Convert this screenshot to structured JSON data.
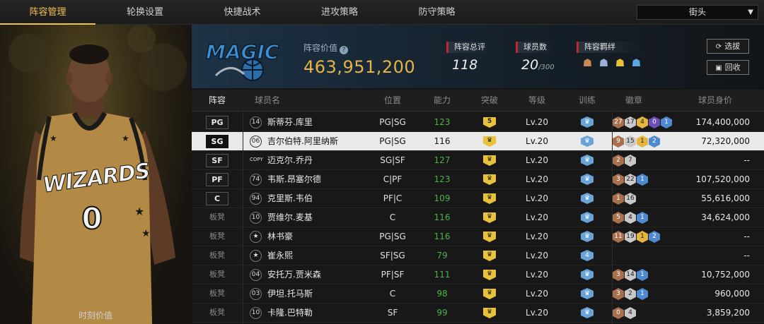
{
  "tabs": [
    {
      "label": "阵容管理",
      "active": true
    },
    {
      "label": "轮换设置"
    },
    {
      "label": "快捷战术"
    },
    {
      "label": "进攻策略"
    },
    {
      "label": "防守策略"
    }
  ],
  "dropdown": {
    "value": "街头"
  },
  "player_panel": {
    "caption": "时刻价值",
    "jersey_team": "WIZARDS",
    "jersey_number": "0"
  },
  "team": {
    "logo_text": "MAGIC",
    "value_label": "阵容价值",
    "value": "463,951,200",
    "rating_label": "阵容总评",
    "rating": "118",
    "players_label": "球员数",
    "players_count": "20",
    "players_max": "/300",
    "bond_label": "阵容羁绊",
    "bond_icons": [
      "team-bond-icon-1",
      "team-bond-icon-2",
      "team-bond-icon-3",
      "team-bond-icon-4"
    ]
  },
  "buttons": {
    "select": "选拔",
    "recycle": "回收"
  },
  "columns": [
    "阵容",
    "球员名",
    "位置",
    "能力",
    "突破",
    "等级",
    "训练",
    "徽章",
    "球员身价"
  ],
  "rows": [
    {
      "slot": "PG",
      "jersey": "14",
      "name": "斯蒂芬.库里",
      "pos": "PG|SG",
      "ability": "123",
      "breakthrough": "5",
      "level": "Lv.20",
      "training": "",
      "badges": [
        [
          "bronze",
          "27"
        ],
        [
          "silver",
          "17"
        ],
        [
          "gold",
          "4"
        ],
        [
          "purple",
          "0"
        ],
        [
          "blue",
          "1"
        ]
      ],
      "price": "174,400,000"
    },
    {
      "slot": "SG",
      "jersey": "06",
      "name": "吉尔伯特.阿里纳斯",
      "pos": "PG|SG",
      "ability": "116",
      "breakthrough": "crown",
      "level": "Lv.20",
      "training": "",
      "badges": [
        [
          "bronze",
          "9"
        ],
        [
          "silver",
          "15"
        ],
        [
          "gold",
          "1"
        ],
        [
          "blue",
          "2"
        ]
      ],
      "price": "72,320,000",
      "selected": true
    },
    {
      "slot": "SF",
      "jersey": "COPY",
      "name": "迈克尔.乔丹",
      "pos": "SG|SF",
      "ability": "127",
      "breakthrough": "crown",
      "level": "Lv.20",
      "training": "",
      "badges": [
        [
          "bronze",
          "2"
        ],
        [
          "silver",
          "7"
        ]
      ],
      "price": "--"
    },
    {
      "slot": "PF",
      "jersey": "74",
      "name": "韦斯.昂塞尔德",
      "pos": "C|PF",
      "ability": "123",
      "breakthrough": "crown",
      "level": "Lv.20",
      "training": "",
      "badges": [
        [
          "bronze",
          "3"
        ],
        [
          "silver",
          "22"
        ],
        [
          "blue",
          "1"
        ]
      ],
      "price": "107,520,000"
    },
    {
      "slot": "C",
      "jersey": "94",
      "name": "克里斯.韦伯",
      "pos": "PF|C",
      "ability": "109",
      "breakthrough": "crown",
      "level": "Lv.20",
      "training": "",
      "badges": [
        [
          "bronze",
          "1"
        ],
        [
          "silver",
          "16"
        ]
      ],
      "price": "55,616,000"
    },
    {
      "slot": "板凳",
      "jersey": "10",
      "name": "贾维尔.麦基",
      "pos": "C",
      "ability": "116",
      "breakthrough": "crown",
      "level": "Lv.20",
      "training": "",
      "badges": [
        [
          "bronze",
          "5"
        ],
        [
          "silver",
          "4"
        ],
        [
          "blue",
          "1"
        ]
      ],
      "price": "34,624,000"
    },
    {
      "slot": "板凳",
      "jersey": "star",
      "name": "林书豪",
      "pos": "PG|SG",
      "ability": "116",
      "breakthrough": "crown",
      "level": "Lv.20",
      "training": "",
      "badges": [
        [
          "bronze",
          "11"
        ],
        [
          "silver",
          "19"
        ],
        [
          "gold",
          "1"
        ],
        [
          "blue",
          "2"
        ]
      ],
      "price": "--"
    },
    {
      "slot": "板凳",
      "jersey": "star",
      "name": "崔永熙",
      "pos": "SF|SG",
      "ability": "79",
      "breakthrough": "crown",
      "level": "Lv.20",
      "training": "4",
      "badges": [],
      "price": "--"
    },
    {
      "slot": "板凳",
      "jersey": "04",
      "name": "安托万.贾米森",
      "pos": "PF|SF",
      "ability": "111",
      "breakthrough": "crown",
      "level": "Lv.20",
      "training": "",
      "badges": [
        [
          "bronze",
          "3"
        ],
        [
          "silver",
          "14"
        ],
        [
          "blue",
          "1"
        ]
      ],
      "price": "10,752,000"
    },
    {
      "slot": "板凳",
      "jersey": "03",
      "name": "伊坦.托马斯",
      "pos": "C",
      "ability": "98",
      "breakthrough": "crown",
      "level": "Lv.20",
      "training": "",
      "badges": [
        [
          "bronze",
          "3"
        ],
        [
          "silver",
          "2"
        ],
        [
          "blue",
          "1"
        ]
      ],
      "price": "960,000"
    },
    {
      "slot": "板凳",
      "jersey": "10",
      "name": "卡隆.巴特勒",
      "pos": "SF",
      "ability": "99",
      "breakthrough": "crown",
      "level": "Lv.20",
      "training": "",
      "badges": [
        [
          "bronze",
          "0"
        ],
        [
          "silver",
          "4"
        ]
      ],
      "price": "3,859,200"
    }
  ],
  "colors": {
    "accent": "#f2c14e",
    "value": "#e6b445",
    "ability_green": "#4bb24b",
    "breakthrough_gold": "#e8c23a",
    "training_blue": "#6aa4d6"
  }
}
